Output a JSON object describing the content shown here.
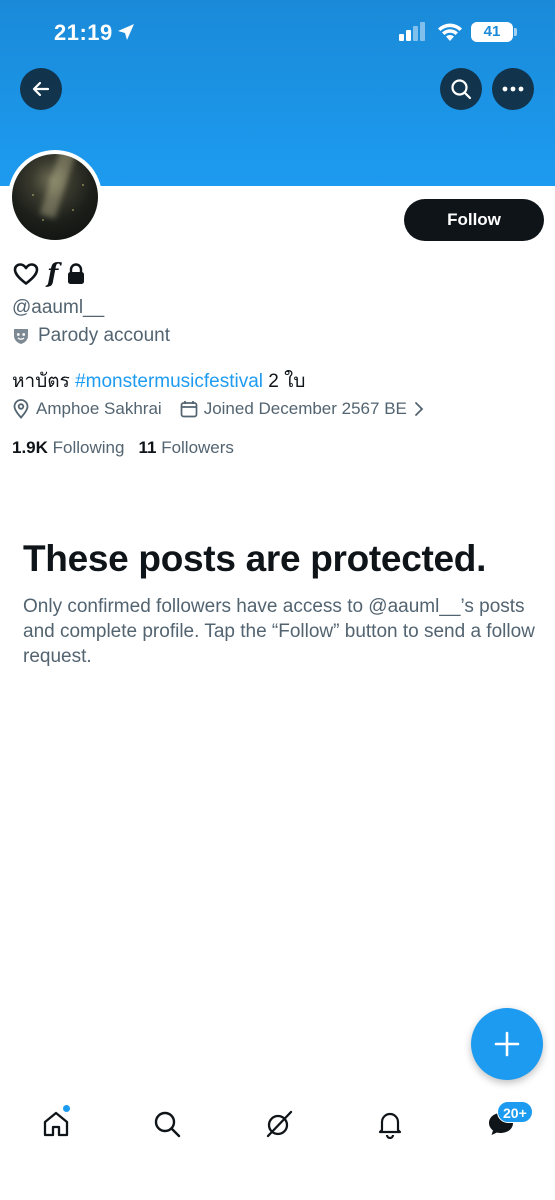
{
  "status_bar": {
    "time": "21:19",
    "battery": "41",
    "icons": [
      "location-arrow-icon",
      "cellular-signal-icon",
      "wifi-icon",
      "battery-icon"
    ]
  },
  "header": {
    "icons": [
      "back-arrow-icon",
      "search-icon",
      "more-icon"
    ]
  },
  "profile": {
    "handle": "@aauml__",
    "name_glyph": "f",
    "name_icons": [
      "heart-icon",
      "lock-icon"
    ],
    "parody_label": "Parody account",
    "bio_prefix": "หาบัตร ",
    "bio_hashtag": "#monstermusicfestival",
    "bio_suffix": " 2 ใบ",
    "location": "Amphoe Sakhrai",
    "joined": "Joined December 2567 BE",
    "following_count": "1.9K",
    "following_label": "Following",
    "followers_count": "11",
    "followers_label": "Followers"
  },
  "actions": {
    "follow_label": "Follow"
  },
  "protected": {
    "title": "These posts are protected.",
    "message": "Only confirmed followers have access to @aauml__’s posts and complete profile. Tap the “Follow” button to send a follow request."
  },
  "tabbar": {
    "items": [
      "home",
      "search",
      "grok",
      "notifications",
      "messages"
    ],
    "messages_badge": "20+"
  },
  "colors": {
    "accent": "#1d9bf0",
    "text_primary": "#0f1419",
    "text_secondary": "#536471"
  }
}
